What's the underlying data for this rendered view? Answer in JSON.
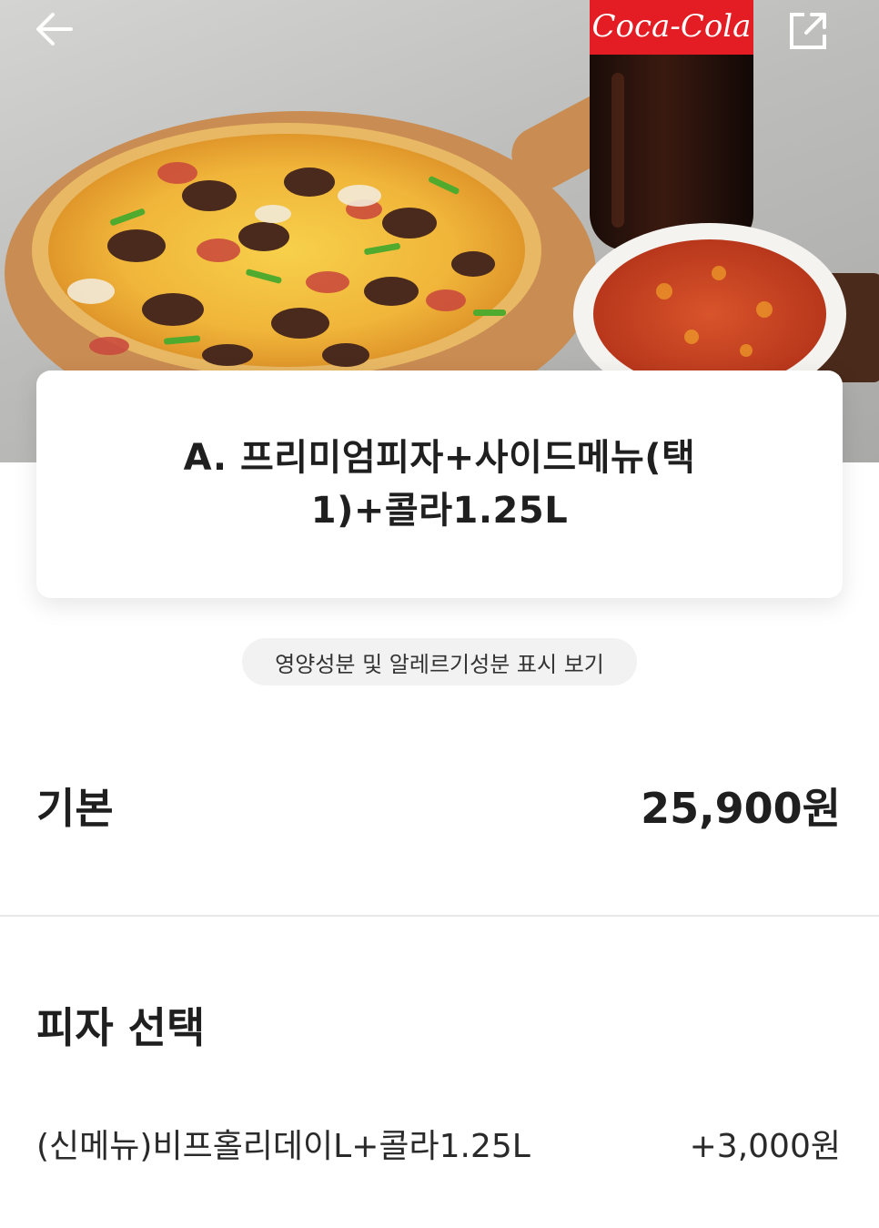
{
  "header": {
    "back_icon": "arrow-left-icon",
    "share_icon": "external-share-icon",
    "bottle_label": "Coca-Cola"
  },
  "product": {
    "title": "A. 프리미엄피자+사이드메뉴(택1)+콜라1.25L"
  },
  "nutrition": {
    "link_label": "영양성분 및 알레르기성분 표시 보기"
  },
  "base": {
    "label": "기본",
    "price": "25,900원"
  },
  "pizza_select": {
    "title": "피자 선택",
    "options": [
      {
        "name": "(신메뉴)비프홀리데이L+콜라1.25L",
        "price": "+3,000원"
      }
    ]
  },
  "colors": {
    "text": "#1f1f1f",
    "chip_bg": "#f2f2f2",
    "divider": "#e8e8e8",
    "coke_red": "#e41c23"
  }
}
